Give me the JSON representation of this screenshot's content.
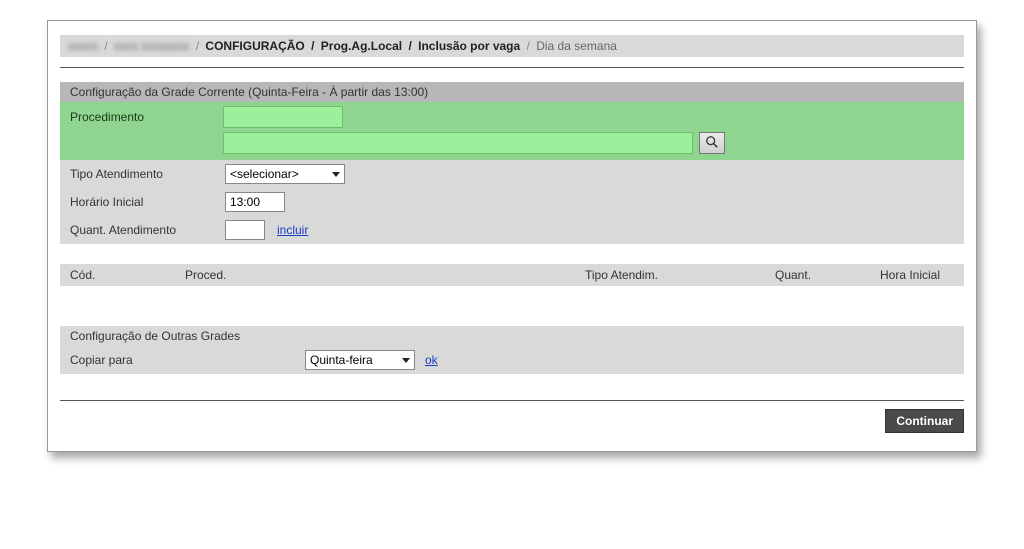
{
  "breadcrumb": {
    "blur1": "xxxxx",
    "blur2": "xxxx xxxxxxxx",
    "configuracao": "CONFIGURAÇÃO",
    "prog": "Prog.Ag.Local",
    "inclusao": "Inclusão por vaga",
    "dia": "Dia da semana"
  },
  "section1": {
    "title": "Configuração da Grade Corrente (Quinta-Feira - À partir das 13:00)"
  },
  "labels": {
    "procedimento": "Procedimento",
    "tipo_atendimento": "Tipo Atendimento",
    "horario_inicial": "Horário Inicial",
    "quant_atend": "Quant. Atendimento",
    "incluir": "incluir"
  },
  "values": {
    "procedimento_code": "",
    "procedimento_desc": "",
    "tipo_sel": "<selecionar>",
    "horario_inicial": "13:00",
    "quant": ""
  },
  "table_headers": {
    "cod": "Cód.",
    "proced": "Proced.",
    "tipo": "Tipo Atendim.",
    "quant": "Quant.",
    "hora": "Hora Inicial"
  },
  "section2": {
    "title": "Configuração de Outras Grades",
    "copiar_para": "Copiar para",
    "dia_sel": "Quinta-feira",
    "ok": "ok"
  },
  "footer": {
    "continuar": "Continuar"
  }
}
